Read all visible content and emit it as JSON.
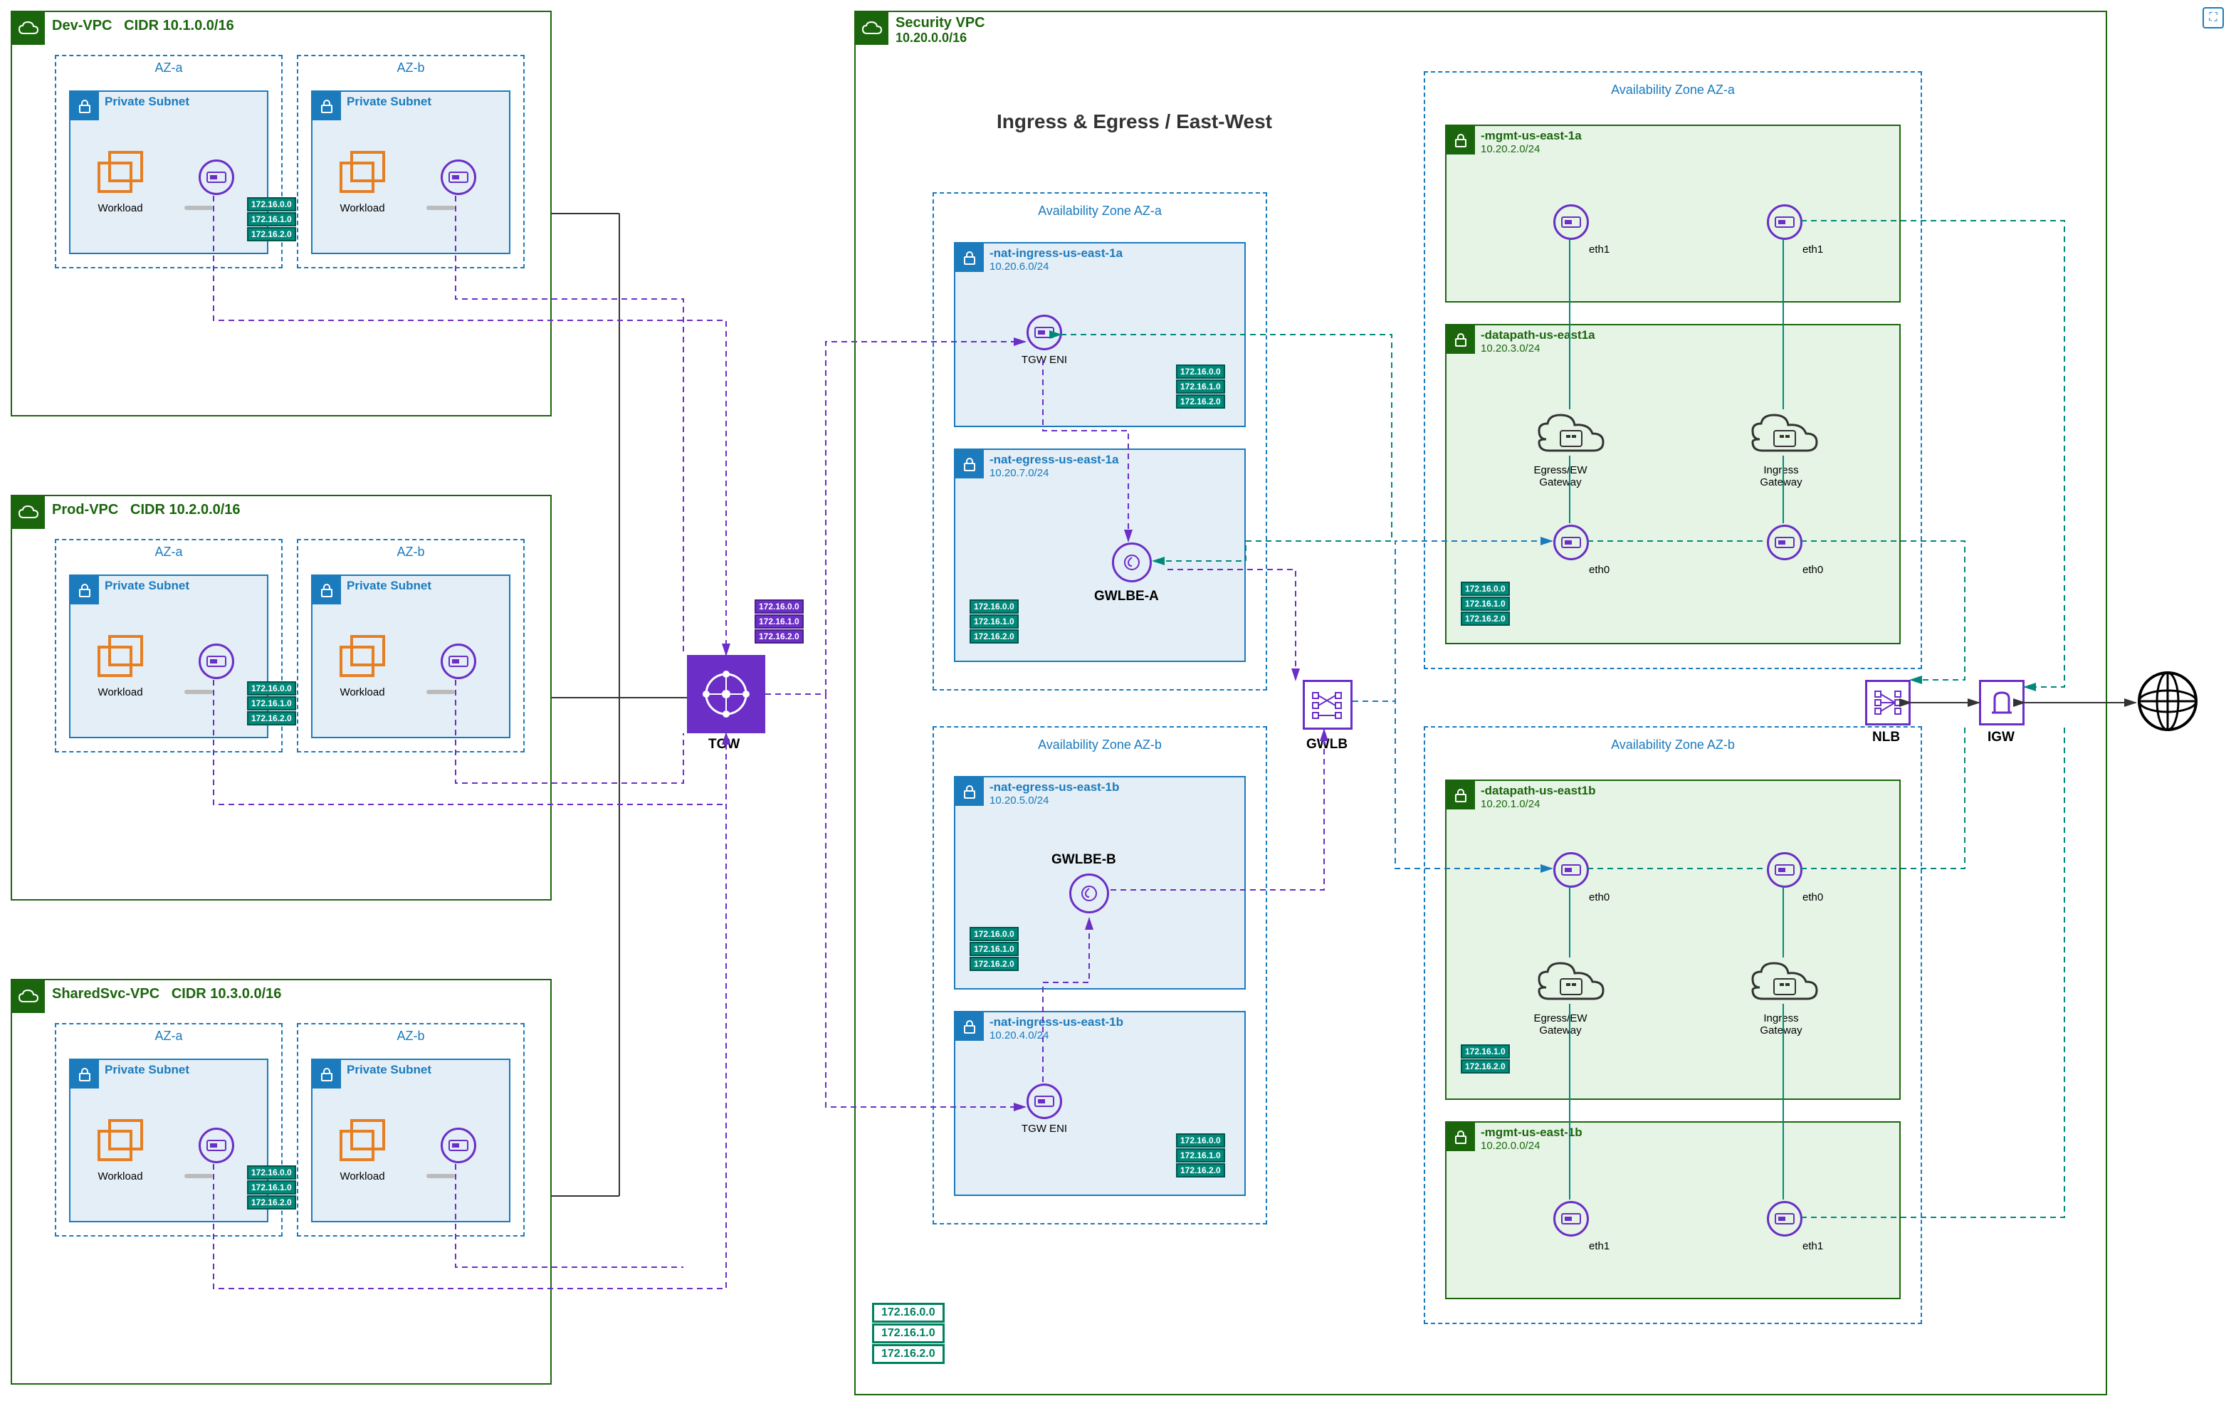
{
  "dev_vpc": {
    "name": "Dev-VPC",
    "cidr": "CIDR 10.1.0.0/16"
  },
  "prod_vpc": {
    "name": "Prod-VPC",
    "cidr": "CIDR 10.2.0.0/16"
  },
  "shared_vpc": {
    "name": "SharedSvc-VPC",
    "cidr": "CIDR 10.3.0.0/16"
  },
  "sec_vpc": {
    "name": "Security VPC",
    "cidr": "10.20.0.0/16"
  },
  "az_a": "AZ-a",
  "az_b": "AZ-b",
  "private_subnet": "Private Subnet",
  "workload": "Workload",
  "tgw": "TGW",
  "heading": "Ingress & Egress / East-West",
  "avz_a": "Availability Zone AZ-a",
  "avz_b": "Availability Zone AZ-b",
  "nat_ingress_a": {
    "name": "-nat-ingress-us-east-1a",
    "cidr": "10.20.6.0/24"
  },
  "nat_egress_a": {
    "name": "-nat-egress-us-east-1a",
    "cidr": "10.20.7.0/24"
  },
  "nat_egress_b": {
    "name": "-nat-egress-us-east-1b",
    "cidr": "10.20.5.0/24"
  },
  "nat_ingress_b": {
    "name": "-nat-ingress-us-east-1b",
    "cidr": "10.20.4.0/24"
  },
  "tgw_eni": "TGW ENI",
  "gwlbe_a": "GWLBE-A",
  "gwlbe_b": "GWLBE-B",
  "gwlb": "GWLB",
  "mgmt_a": {
    "name": "-mgmt-us-east-1a",
    "cidr": "10.20.2.0/24"
  },
  "datapath_a": {
    "name": "-datapath-us-east1a",
    "cidr": "10.20.3.0/24"
  },
  "datapath_b": {
    "name": "-datapath-us-east1b",
    "cidr": "10.20.1.0/24"
  },
  "mgmt_b": {
    "name": "-mgmt-us-east-1b",
    "cidr": "10.20.0.0/24"
  },
  "eth0": "eth0",
  "eth1": "eth1",
  "egress_gw": "Egress/EW\nGateway",
  "ingress_gw": "Ingress\nGateway",
  "nlb": "NLB",
  "igw": "IGW",
  "cidr1": "172.16.0.0",
  "cidr2": "172.16.1.0",
  "cidr3": "172.16.2.0",
  "legend1": "172.16.0.0",
  "legend2": "172.16.1.0",
  "legend3": "172.16.2.0"
}
